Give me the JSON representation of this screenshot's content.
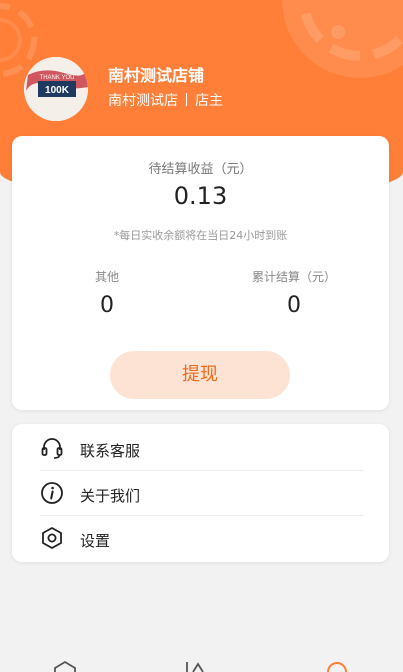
{
  "colors": {
    "accent": "#ff7e38",
    "withdraw_bg": "#fde3d3",
    "withdraw_text": "#f06a1e"
  },
  "profile": {
    "shop_name": "南村测试店铺",
    "store": "南村测试店",
    "role": "店主",
    "avatar_text_top": "THANK YOU",
    "avatar_text_main": "100K"
  },
  "earnings": {
    "pending_label": "待结算收益（元）",
    "pending_value": "0.13",
    "note": "*每日实收余额将在当日24小时到账",
    "other_label": "其他",
    "other_value": "0",
    "total_label": "累计结算（元）",
    "total_value": "0",
    "withdraw_label": "提现"
  },
  "menu": [
    {
      "label": "联系客服",
      "icon": "headset-icon"
    },
    {
      "label": "关于我们",
      "icon": "info-icon"
    },
    {
      "label": "设置",
      "icon": "settings-hexagon-icon"
    }
  ],
  "bottom_nav": [
    {
      "icon": "home-hexagon-icon"
    },
    {
      "icon": "chart-icon"
    },
    {
      "icon": "profile-icon"
    }
  ]
}
